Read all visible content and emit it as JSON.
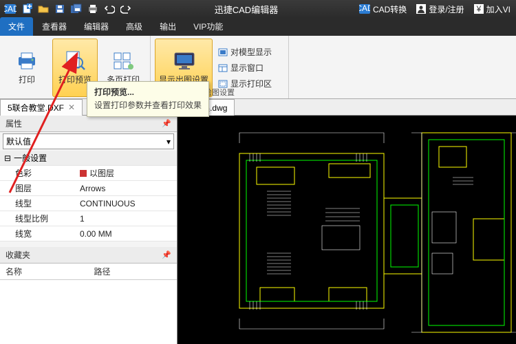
{
  "app": {
    "title": "迅捷CAD编辑器"
  },
  "qat_icons": [
    "cad-logo-icon",
    "new-icon",
    "open-icon",
    "save-icon",
    "saveall-icon",
    "print-icon",
    "undo-icon",
    "redo-icon"
  ],
  "titlebar_right": {
    "convert": "CAD转换",
    "login": "登录/注册",
    "join": "加入VI"
  },
  "tabs": {
    "items": [
      "文件",
      "查看器",
      "编辑器",
      "高级",
      "输出",
      "VIP功能"
    ],
    "active": 0
  },
  "ribbon": {
    "print": "打印",
    "preview": "打印预览",
    "multi": "多页打印",
    "plot": "显示出图设置",
    "model": "对模型显示",
    "window": "显示窗口",
    "plotarea": "显示打印区",
    "group2_label": "绘图设置"
  },
  "tooltip": {
    "title": "打印预览...",
    "body": "设置打印参数并查看打印效果"
  },
  "doc_tabs": {
    "items": [
      "5联合教堂.DXF",
      "一字型衣柜内部结构设计图集.dwg"
    ]
  },
  "props": {
    "panel": "属性",
    "default": "默认值",
    "section": "一般设置",
    "rows": [
      {
        "k": "色彩",
        "v": "以图层",
        "chip": true
      },
      {
        "k": "图层",
        "v": "Arrows"
      },
      {
        "k": "线型",
        "v": "CONTINUOUS"
      },
      {
        "k": "线型比例",
        "v": "1"
      },
      {
        "k": "线宽",
        "v": "0.00 MM"
      }
    ],
    "fav": "收藏夹",
    "col1": "名称",
    "col2": "路径"
  }
}
